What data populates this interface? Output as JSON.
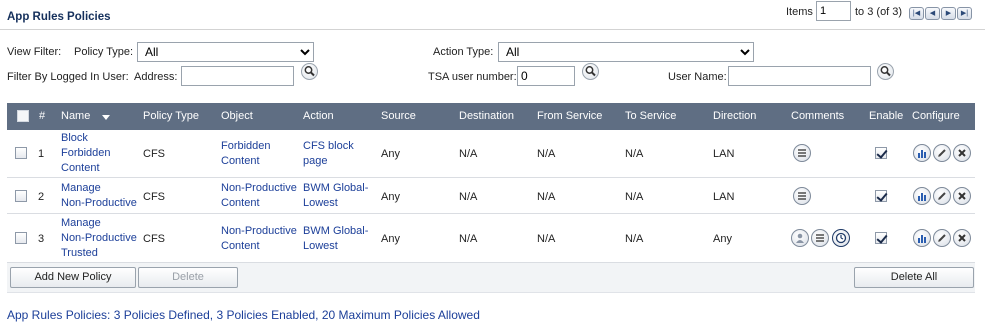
{
  "title": "App Rules Policies",
  "pager": {
    "items_label": "Items",
    "items_value": "1",
    "range_text": "to 3 (of 3)",
    "first": "|◀",
    "prev": "◀",
    "next": "▶",
    "last": "▶|"
  },
  "filters": {
    "view_filter_label": "View Filter:",
    "policy_type_label": "Policy Type:",
    "policy_type_value": "All",
    "action_type_label": "Action Type:",
    "action_type_value": "All",
    "logged_in_label": "Filter By Logged In User:",
    "address_label": "Address:",
    "address_value": "",
    "tsa_label": "TSA user number:",
    "tsa_value": "0",
    "username_label": "User Name:",
    "username_value": ""
  },
  "columns": [
    "#",
    "Name",
    "Policy Type",
    "Object",
    "Action",
    "Source",
    "Destination",
    "From Service",
    "To Service",
    "Direction",
    "Comments",
    "Enable",
    "Configure"
  ],
  "rows": [
    {
      "num": "1",
      "name": [
        "Block",
        "Forbidden",
        "Content"
      ],
      "policy_type": "CFS",
      "object": [
        "Forbidden",
        "Content"
      ],
      "action": [
        "CFS block",
        "page"
      ],
      "source": "Any",
      "destination": "N/A",
      "from_service": "N/A",
      "to_service": "N/A",
      "direction": "LAN",
      "enabled": true,
      "comment_icons": [
        "comment-icon"
      ]
    },
    {
      "num": "2",
      "name": [
        "Manage",
        "Non-Productive"
      ],
      "policy_type": "CFS",
      "object": [
        "Non-Productive",
        "Content"
      ],
      "action": [
        "BWM Global-",
        "Lowest"
      ],
      "source": "Any",
      "destination": "N/A",
      "from_service": "N/A",
      "to_service": "N/A",
      "direction": "LAN",
      "enabled": true,
      "comment_icons": [
        "comment-icon"
      ]
    },
    {
      "num": "3",
      "name": [
        "Manage",
        "Non-Productive",
        "Trusted"
      ],
      "policy_type": "CFS",
      "object": [
        "Non-Productive",
        "Content"
      ],
      "action": [
        "BWM Global-",
        "Lowest"
      ],
      "source": "Any",
      "destination": "N/A",
      "from_service": "N/A",
      "to_service": "N/A",
      "direction": "Any",
      "enabled": true,
      "comment_icons": [
        "user-icon",
        "comment-icon",
        "clock-icon"
      ]
    }
  ],
  "buttons": {
    "add": "Add New Policy",
    "delete": "Delete",
    "delete_all": "Delete All"
  },
  "summary": "App Rules Policies:  3 Policies Defined, 3 Policies Enabled, 20 Maximum Policies Allowed",
  "colors": {
    "header_bg": "#5f6e83",
    "link": "#1c3f99",
    "title": "#15305c"
  }
}
